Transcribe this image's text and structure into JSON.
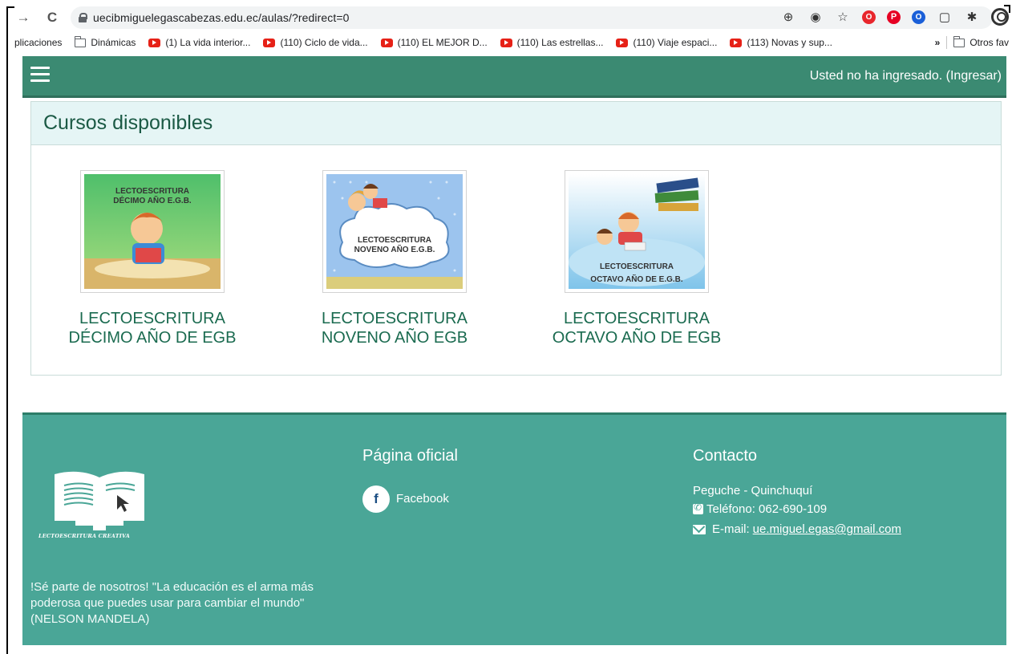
{
  "browser": {
    "url": "uecibmiguelegascabezas.edu.ec/aulas/?redirect=0",
    "bookmarks": [
      {
        "label": "plicaciones",
        "icon": "none"
      },
      {
        "label": "Dinámicas",
        "icon": "folder-icon"
      },
      {
        "label": "(1) La vida interior...",
        "icon": "youtube-icon"
      },
      {
        "label": "(110) Ciclo de vida...",
        "icon": "youtube-icon"
      },
      {
        "label": "(110) EL MEJOR D...",
        "icon": "youtube-icon"
      },
      {
        "label": "(110) Las estrellas...",
        "icon": "youtube-icon"
      },
      {
        "label": "(110) Viaje espaci...",
        "icon": "youtube-icon"
      },
      {
        "label": "(113) Novas y sup...",
        "icon": "youtube-icon"
      }
    ],
    "bookmarks_more": "»",
    "other_bookmarks": "Otros fav"
  },
  "header": {
    "login_text": "Usted no ha ingresado. (Ingresar)",
    "bg_color": "#3b8a72"
  },
  "courses": {
    "heading": "Cursos disponibles",
    "items": [
      {
        "title_line1": "LECTOESCRITURA",
        "title_line2": "DÉCIMO AÑO DE EGB",
        "thumb_line1": "LECTOESCRITURA",
        "thumb_line2": "DÉCIMO AÑO E.G.B."
      },
      {
        "title_line1": "LECTOESCRITURA",
        "title_line2": "NOVENO AÑO EGB",
        "thumb_line1": "LECTOESCRITURA",
        "thumb_line2": "NOVENO AÑO E.G.B."
      },
      {
        "title_line1": "LECTOESCRITURA",
        "title_line2": "OCTAVO AÑO DE EGB",
        "thumb_line1": "LECTOESCRITURA",
        "thumb_line2": "OCTAVO AÑO DE E.G.B."
      }
    ]
  },
  "footer": {
    "logo_caption": "LECTOESCRITURA CREATIVA",
    "quote": "!Sé parte de nosotros! \"La educación es el arma más poderosa que puedes usar para cambiar el mundo\" (NELSON MANDELA)",
    "official_title": "Página oficial",
    "facebook_label": "Facebook",
    "facebook_glyph": "f",
    "contact_title": "Contacto",
    "address": "Peguche - Quinchuquí",
    "phone": "Teléfono: 062-690-109",
    "email_label": "E-mail:",
    "email": "ue.miguel.egas@gmail.com",
    "bg_color": "#4aa697"
  }
}
